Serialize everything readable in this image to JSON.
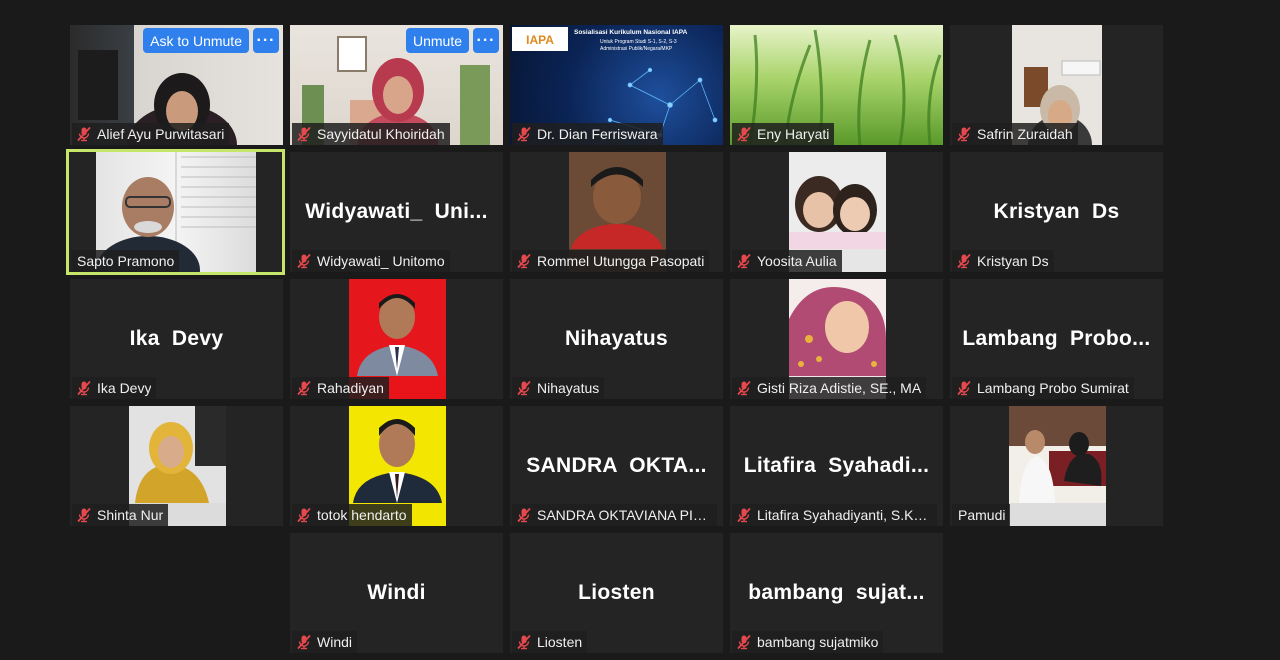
{
  "controls": {
    "ask_to_unmute": "Ask to Unmute",
    "unmute": "Unmute",
    "more": "···"
  },
  "slide": {
    "title": "Sosialisasi Kurikulum Nasional IAPA",
    "line1": "Untuk Program Studi S-1, S-2, S-3",
    "line2": "Administrasi Publik/Negara/MKP",
    "logo": "IAPA"
  },
  "participants": [
    {
      "name": "Alief Ayu Purwitasari"
    },
    {
      "name": "Sayyidatul Khoiridah"
    },
    {
      "name": "Dr. Dian Ferriswara"
    },
    {
      "name": "Eny Haryati"
    },
    {
      "name": "Safrin Zuraidah"
    },
    {
      "name": "Sapto Pramono"
    },
    {
      "name": "Widyawati_ Unitomo",
      "display": "Widyawati_ Uni..."
    },
    {
      "name": "Rommel Utungga Pasopati"
    },
    {
      "name": "Yoosita Aulia"
    },
    {
      "name": "Kristyan Ds",
      "display": "Kristyan Ds"
    },
    {
      "name": "Ika Devy",
      "display": "Ika Devy"
    },
    {
      "name": "Rahadiyan"
    },
    {
      "name": "Nihayatus",
      "display": "Nihayatus"
    },
    {
      "name": "Gisti Riza Adistie, SE., MA"
    },
    {
      "name": "Lambang Probo Sumirat",
      "display": "Lambang Probo..."
    },
    {
      "name": "Shinta Nur"
    },
    {
      "name": "totok hendarto"
    },
    {
      "name": "SANDRA OKTAVIANA PIN...",
      "display": "SANDRA OKTA..."
    },
    {
      "name": "Litafira Syahadiyanti, S.Ko...",
      "display": "Litafira Syahadi..."
    },
    {
      "name": "Pamudi"
    },
    {
      "name": "Windi",
      "display": "Windi"
    },
    {
      "name": "Liosten",
      "display": "Liosten"
    },
    {
      "name": "bambang sujatmiko",
      "display": "bambang sujat..."
    }
  ],
  "colors": {
    "background": "#1a1a1a",
    "tile": "#242424",
    "active_speaker": "#c6e66a",
    "button": "#2f80ed",
    "muted_icon": "#e5484d"
  }
}
